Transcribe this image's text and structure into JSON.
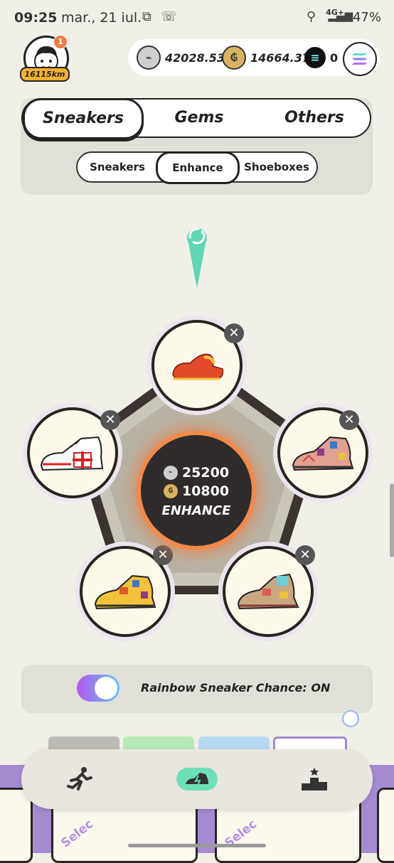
{
  "status_bar": {
    "time": "09:25",
    "date": "mar., 21 iul.",
    "network": "4G+",
    "battery": "47%"
  },
  "profile": {
    "notification_count": "1",
    "distance": "16115km"
  },
  "balances": {
    "gst": "42028.53",
    "gmt": "14664.37",
    "sol": "0"
  },
  "tabs": {
    "main": [
      "Sneakers",
      "Gems",
      "Others"
    ],
    "main_active": "Sneakers",
    "sub": [
      "Sneakers",
      "Enhance",
      "Shoeboxes"
    ],
    "sub_active": "Enhance"
  },
  "enhance": {
    "gst_cost": "25200",
    "gmt_cost": "10800",
    "button_label": "ENHANCE"
  },
  "slots": [
    {
      "name": "top",
      "icon": "red-sneaker-icon"
    },
    {
      "name": "left",
      "icon": "white-red-cross-sneaker-icon"
    },
    {
      "name": "right",
      "icon": "patterned-sneaker-icon"
    },
    {
      "name": "bottom-left",
      "icon": "yellow-patterned-sneaker-icon"
    },
    {
      "name": "bottom-right",
      "icon": "multicolor-sneaker-icon"
    }
  ],
  "rainbow": {
    "label": "Rainbow Sneaker Chance: ON",
    "enabled": true
  },
  "cards": {
    "select_label": "Selec"
  },
  "colors": {
    "accent_green": "#6ee0b8",
    "enhance_glow": "#f28a4a",
    "background": "#f1f0e8",
    "bottom_strip": "#a58bd0"
  }
}
